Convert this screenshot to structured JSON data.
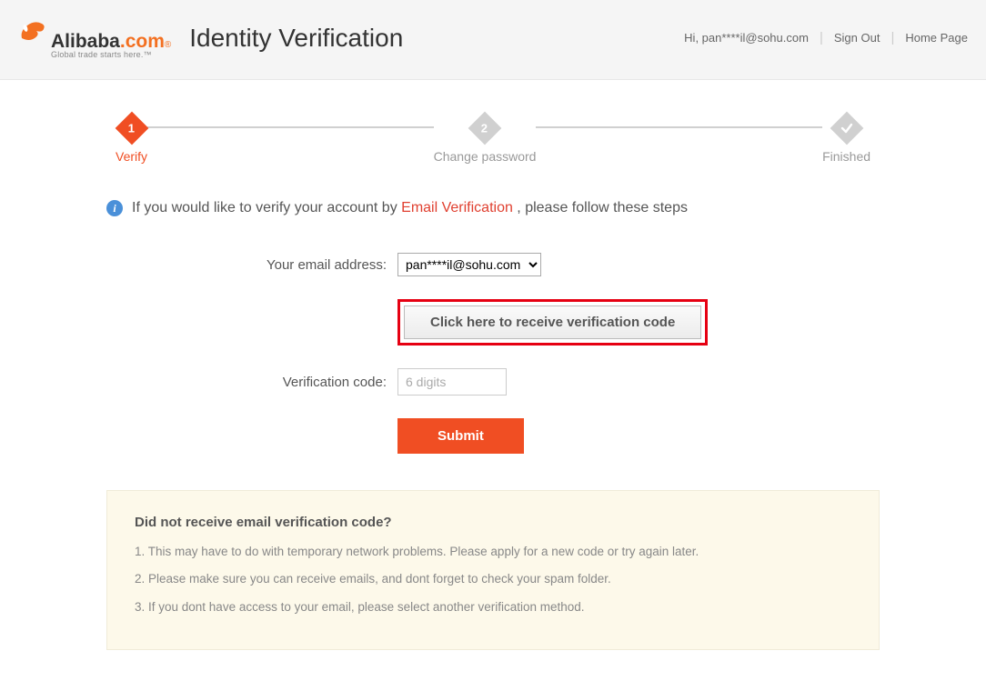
{
  "header": {
    "logo_main": "Alibaba",
    "logo_com": ".com",
    "logo_tag": "Global trade starts here.™",
    "page_title": "Identity Verification",
    "greeting": "Hi, pan****il@sohu.com",
    "sign_out": "Sign Out",
    "home_page": "Home Page"
  },
  "stepper": {
    "step1_num": "1",
    "step1_label": "Verify",
    "step2_num": "2",
    "step2_label": "Change password",
    "step3_label": "Finished"
  },
  "info": {
    "prefix": "If you would like to verify your account by ",
    "method": "Email Verification",
    "suffix": " , please follow these steps"
  },
  "form": {
    "email_label": "Your email address:",
    "email_value": "pan****il@sohu.com",
    "receive_btn": "Click here to receive verification code",
    "code_label": "Verification code:",
    "code_placeholder": "6 digits",
    "submit": "Submit"
  },
  "help": {
    "title": "Did not receive email verification code?",
    "items": [
      "1. This may have to do with temporary network problems. Please apply for a new code or try again later.",
      "2. Please make sure you can receive emails, and dont forget to check your spam folder.",
      "3. If you dont have access to your email, please select another verification method."
    ]
  }
}
